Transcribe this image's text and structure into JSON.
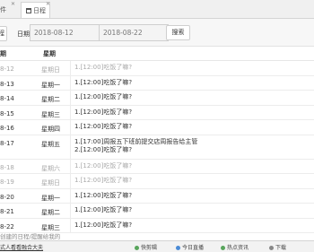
{
  "tabs": {
    "prev_label": "件",
    "prev_close": "✕",
    "active_label": "日程",
    "active_close": "✕"
  },
  "filter": {
    "prev_button": "程",
    "date_label": "日期",
    "start_date": "2018-08-12",
    "to_label": "至",
    "end_date": "2018-08-22",
    "search_label": "搜索"
  },
  "table": {
    "headers": {
      "date": "期",
      "week": "星期"
    },
    "rows": [
      {
        "date": "8-12",
        "week": "星期日",
        "tasks": [
          "1.[12:00]吃饭了嘛?"
        ],
        "muted": true
      },
      {
        "date": "8-13",
        "week": "星期一",
        "tasks": [
          "1.[12:00]吃饭了嘛?"
        ],
        "muted": false
      },
      {
        "date": "8-14",
        "week": "星期二",
        "tasks": [
          "1.[12:00]吃饭了嘛?"
        ],
        "muted": false
      },
      {
        "date": "8-15",
        "week": "星期三",
        "tasks": [
          "1.[12:00]吃饭了嘛?"
        ],
        "muted": false
      },
      {
        "date": "8-16",
        "week": "星期四",
        "tasks": [
          "1.[12:00]吃饭了嘛?"
        ],
        "muted": false
      },
      {
        "date": "8-17",
        "week": "星期五",
        "tasks": [
          "1.[17:00]周报五下班前提交店周报告给主管",
          "2.[12:00]吃饭了嘛?"
        ],
        "muted": false
      },
      {
        "date": "8-18",
        "week": "星期六",
        "tasks": [
          "1.[12:00]吃饭了嘛?"
        ],
        "muted": true
      },
      {
        "date": "8-19",
        "week": "星期日",
        "tasks": [
          "1.[12:00]吃饭了嘛?"
        ],
        "muted": true
      },
      {
        "date": "8-20",
        "week": "星期一",
        "tasks": [
          "1.[12:00]吃饭了嘛?"
        ],
        "muted": false
      },
      {
        "date": "8-21",
        "week": "星期二",
        "tasks": [
          "1.[12:00]吃饭了嘛?"
        ],
        "muted": false
      },
      {
        "date": "8-22",
        "week": "星期三",
        "tasks": [
          "1.[12:00]吃饭了嘛?"
        ],
        "muted": false
      }
    ]
  },
  "footer_note": "创建的日程/提醒给我的",
  "statusbar": {
    "left_link": "式人看看融合大夫",
    "items": [
      {
        "label": "快剪辑",
        "icon": "scissors-icon"
      },
      {
        "label": "今日直播",
        "icon": "live-icon"
      },
      {
        "label": "热点资讯",
        "icon": "news-icon"
      },
      {
        "label": "下载",
        "icon": "download-icon"
      }
    ]
  }
}
